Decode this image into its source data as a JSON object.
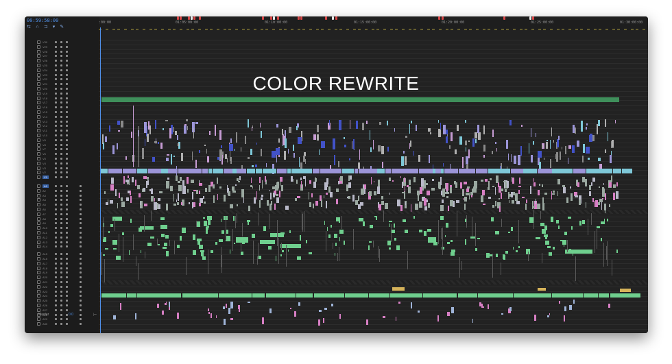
{
  "timecode": "00:59:58:00",
  "ruler_labels": [
    ":00:00",
    "01:05:00:00",
    "01:10:00:00",
    "01:15:00:00",
    "01:20:00:00",
    "01:25:00:00",
    "01:30:00:00"
  ],
  "video_tracks": [
    "V30",
    "V29",
    "V28",
    "V27",
    "V26",
    "V25",
    "V24",
    "V23",
    "V22",
    "V21",
    "V20",
    "V19",
    "V18",
    "V17",
    "V16",
    "V15",
    "V14",
    "V13",
    "V12",
    "V11",
    "V10",
    "V9",
    "V8",
    "V7",
    "V6",
    "V5",
    "V4",
    "V3",
    "V2",
    "V1"
  ],
  "audio_tracks": [
    "A1",
    "A2",
    "A3",
    "A4",
    "A5",
    "A6",
    "A7",
    "A8",
    "A9",
    "A10",
    "A11",
    "A12",
    "A13",
    "A14",
    "A15",
    "A16",
    "A17",
    "A18",
    "A19",
    "A20",
    "A21",
    "A22",
    "A23",
    "A24",
    "A25",
    "A26",
    "A27",
    "A28",
    "A29",
    "A30"
  ],
  "selected_video_track": "V1",
  "selected_audio_track": "A1",
  "master": {
    "label": "Master",
    "value": "0.0"
  },
  "overlay_title": "COLOR REWRITE",
  "colors": {
    "timecode": "#4f8fe8",
    "video_clip_lavender": "#9c95d8",
    "video_clip_cyan": "#7ec8d8",
    "video_clip_blue": "#4252c8",
    "audio_clip_green": "#6fcf8e",
    "audio_clip_pink": "#d77fc4",
    "adjustment_layer": "#3f8f5b",
    "marker_red": "#d64545"
  },
  "tool_icons": [
    "ripple-icon",
    "magnet-icon",
    "link-icon",
    "marker-icon",
    "wrench-icon"
  ]
}
